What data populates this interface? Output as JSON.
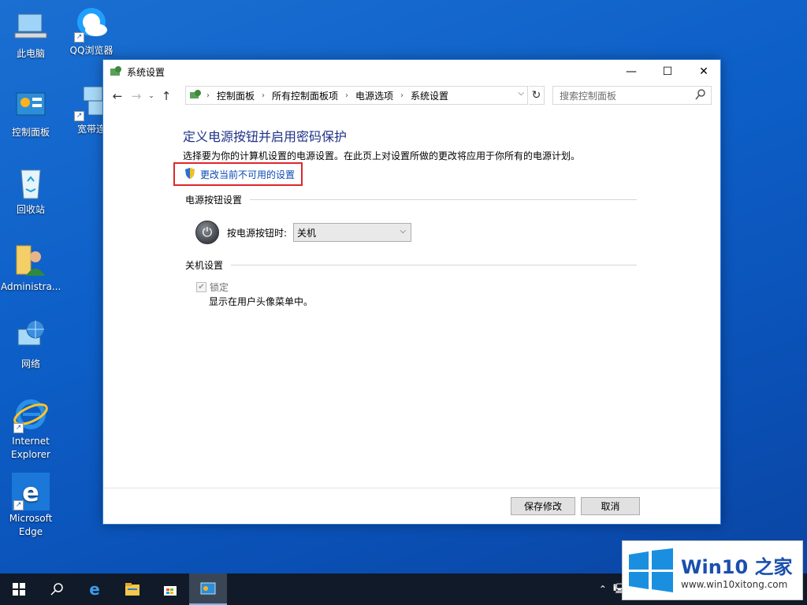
{
  "desktop": {
    "icons": [
      {
        "label": "此电脑"
      },
      {
        "label": "QQ浏览器"
      },
      {
        "label": "控制面板"
      },
      {
        "label": "宽带连"
      },
      {
        "label": "回收站"
      },
      {
        "label": "Administra..."
      },
      {
        "label": "网络"
      },
      {
        "label": "Internet Explorer"
      },
      {
        "label": "Microsoft Edge"
      }
    ]
  },
  "window": {
    "title": "系统设置",
    "controls": {
      "minimize": "—",
      "maximize": "☐",
      "close": "✕"
    },
    "breadcrumb": [
      "控制面板",
      "所有控制面板项",
      "电源选项",
      "系统设置"
    ],
    "search_placeholder": "搜索控制面板",
    "heading": "定义电源按钮并启用密码保护",
    "description": "选择要为你的计算机设置的电源设置。在此页上对设置所做的更改将应用于你所有的电源计划。",
    "change_link": "更改当前不可用的设置",
    "power_section_title": "电源按钮设置",
    "power_button_label": "按电源按钮时:",
    "power_button_value": "关机",
    "shutdown_section_title": "关机设置",
    "lock_label": "锁定",
    "lock_checked": true,
    "lock_description": "显示在用户头像菜单中。",
    "save_button": "保存修改",
    "cancel_button": "取消"
  },
  "watermark": {
    "title": "Win10 之家",
    "url": "www.win10xitong.com",
    "accent": "#1a8fe0"
  }
}
